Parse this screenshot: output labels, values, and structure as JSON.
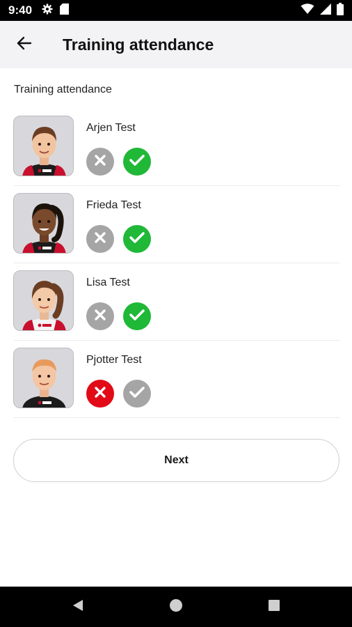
{
  "status_bar": {
    "time": "9:40",
    "left_icons": [
      "gear-icon",
      "sd-card-icon"
    ],
    "right_icons": [
      "wifi-icon",
      "signal-icon",
      "battery-icon"
    ]
  },
  "app_bar": {
    "back_icon": "arrow-left-icon",
    "title": "Training attendance"
  },
  "section_label": "Training attendance",
  "players": [
    {
      "name": "Arjen Test",
      "absent_selected": false,
      "present_selected": true
    },
    {
      "name": "Frieda Test",
      "absent_selected": false,
      "present_selected": true
    },
    {
      "name": "Lisa Test",
      "absent_selected": false,
      "present_selected": true
    },
    {
      "name": "Pjotter Test",
      "absent_selected": true,
      "present_selected": false
    }
  ],
  "next_button": {
    "label": "Next"
  },
  "colors": {
    "present_active": "#1fb837",
    "absent_active": "#e20a17",
    "inactive": "#a5a5a5"
  },
  "nav_bar": {
    "buttons": [
      "back-triangle-icon",
      "home-circle-icon",
      "recents-square-icon"
    ]
  }
}
